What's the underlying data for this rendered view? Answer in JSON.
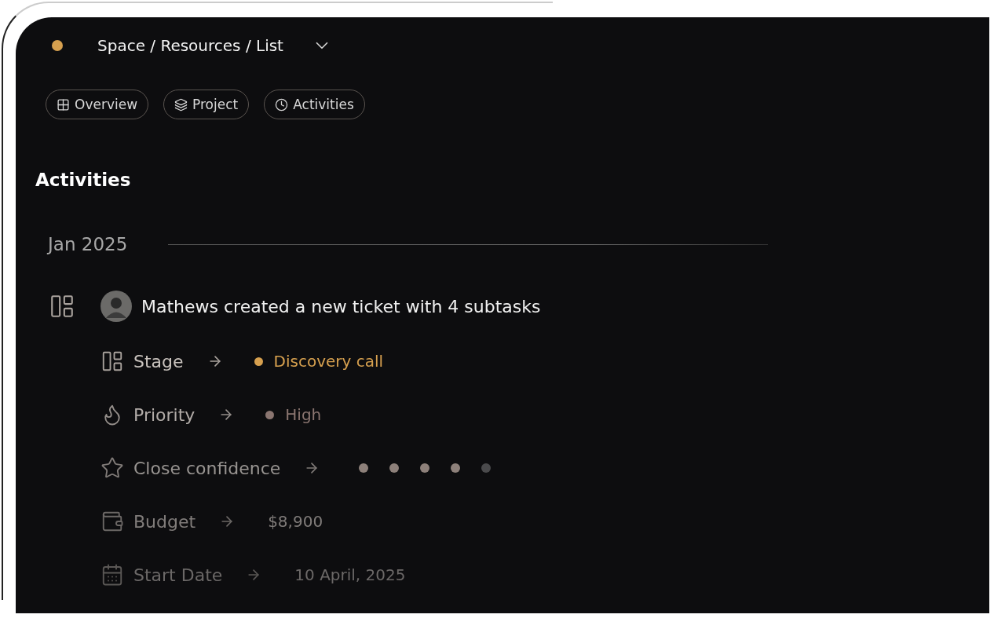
{
  "header": {
    "breadcrumb": "Space / Resources / List"
  },
  "tabs": [
    {
      "label": "Overview",
      "selected": false
    },
    {
      "label": "Project",
      "selected": false
    },
    {
      "label": "Activities",
      "selected": false
    }
  ],
  "section_title": "Activities",
  "month": "Jan 2025",
  "activity": {
    "text": "Mathews created a new ticket with 4 subtasks",
    "changes": [
      {
        "kind": "status",
        "label": "Stage",
        "value": "Discovery call",
        "color": "#d6a04f"
      },
      {
        "kind": "status",
        "label": "Priority",
        "value": "High",
        "color": "#8a7570"
      },
      {
        "kind": "stars",
        "label": "Close confidence",
        "stars": 4
      },
      {
        "kind": "text",
        "label": "Budget",
        "value": "$8,900"
      },
      {
        "kind": "text",
        "label": "Start Date",
        "value": "10 April, 2025"
      }
    ]
  }
}
